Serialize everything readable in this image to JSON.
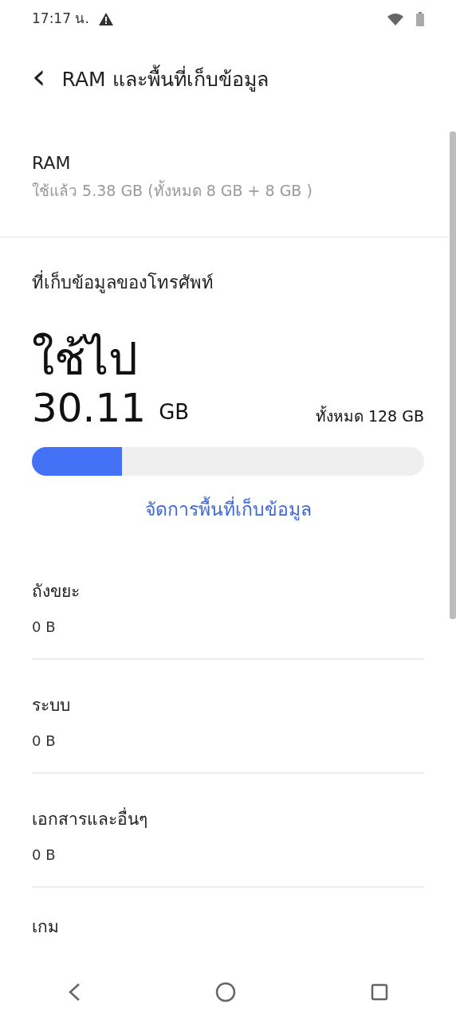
{
  "status_bar": {
    "time": "17:17 น."
  },
  "header": {
    "back": "‹",
    "title": "RAM และพื้นที่เก็บข้อมูล"
  },
  "ram": {
    "title": "RAM",
    "usage": "ใช้แล้ว 5.38 GB (ทั้งหมด 8 GB + 8 GB )"
  },
  "storage": {
    "title": "ที่เก็บข้อมูลของโทรศัพท์",
    "used_label": "ใช้ไป",
    "used_value": "30.11",
    "used_unit": "GB",
    "total": "ทั้งหมด 128 GB",
    "level": 0.23,
    "manage_link": "จัดการพื้นที่เก็บข้อมูล"
  },
  "categories": [
    {
      "name": "ถังขยะ",
      "size": "0 B"
    },
    {
      "name": "ระบบ",
      "size": "0 B"
    },
    {
      "name": "เอกสารและอื่นๆ",
      "size": "0 B"
    },
    {
      "name": "เกม"
    }
  ]
}
